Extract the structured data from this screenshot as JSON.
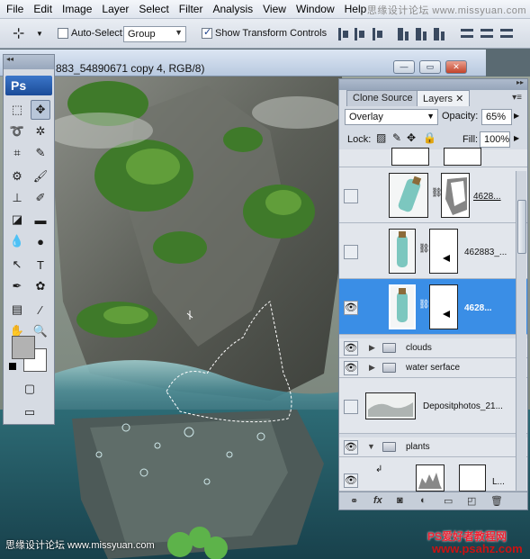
{
  "menubar": {
    "items": [
      "File",
      "Edit",
      "Image",
      "Layer",
      "Select",
      "Filter",
      "Analysis",
      "View",
      "Window",
      "Help"
    ],
    "watermark": "思缘设计论坛 www.missyuan.com"
  },
  "options": {
    "auto_select_label": "Auto-Select:",
    "auto_select_value": "Group",
    "transform_controls_label": "Show Transform Controls"
  },
  "document": {
    "title": "883_54890671 copy 4, RGB/8)"
  },
  "tools": {
    "logo": "Ps"
  },
  "layers_panel": {
    "tabs": [
      "Clone Source",
      "Layers"
    ],
    "blend_mode": "Overlay",
    "opacity_label": "Opacity:",
    "opacity_value": "65%",
    "lock_label": "Lock:",
    "fill_label": "Fill:",
    "fill_value": "100%",
    "layers": [
      {
        "name": "4628...",
        "visible": false,
        "selected": false
      },
      {
        "name": "462883_...",
        "visible": false,
        "selected": false
      },
      {
        "name": "4628...",
        "visible": true,
        "selected": true
      },
      {
        "name": "clouds",
        "visible": true,
        "group": true
      },
      {
        "name": "water serface",
        "visible": true,
        "group": true
      },
      {
        "name": "Depositphotos_21...",
        "visible": false,
        "selected": false
      },
      {
        "name": "plants",
        "visible": true,
        "group": true
      },
      {
        "name": "L...",
        "visible": true,
        "selected": false
      }
    ]
  },
  "watermarks": {
    "bottom_left": "思缘设计论坛 www.missyuan.com",
    "bottom_right_1": "PS爱好者教程网",
    "bottom_right_2": "www.psahz.com"
  }
}
